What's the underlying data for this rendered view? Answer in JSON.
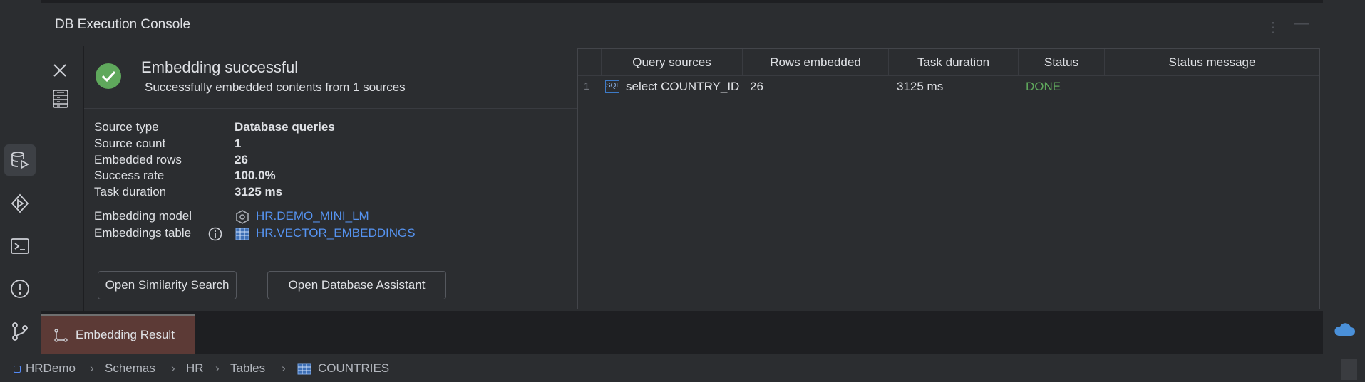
{
  "panel": {
    "title": "DB Execution Console"
  },
  "summary": {
    "title": "Embedding successful",
    "subtitle": "Successfully embedded contents from 1 sources",
    "fields": [
      {
        "label": "Source type",
        "value": "Database queries"
      },
      {
        "label": "Source count",
        "value": "1"
      },
      {
        "label": "Embedded rows",
        "value": "26"
      },
      {
        "label": "Success rate",
        "value": "100.0%"
      },
      {
        "label": "Task duration",
        "value": "3125 ms"
      }
    ],
    "embedding_model_label": "Embedding model",
    "embedding_model_value": "HR.DEMO_MINI_LM",
    "embeddings_table_label": "Embeddings table",
    "embeddings_table_value": "HR.VECTOR_EMBEDDINGS"
  },
  "buttons": {
    "similarity": "Open Similarity Search",
    "assistant": "Open Database Assistant"
  },
  "table": {
    "columns": [
      "Query sources",
      "Rows embedded",
      "Task duration",
      "Status",
      "Status message"
    ],
    "rows": [
      {
        "index": "1",
        "query": "select COUNTRY_ID",
        "rows": "26",
        "duration": "3125 ms",
        "status": "DONE",
        "message": ""
      }
    ],
    "sql_badge": "SQL",
    "status_color": "#5fa85c"
  },
  "bottom_tab": {
    "label": "Embedding Result"
  },
  "breadcrumb": [
    "HRDemo",
    "Schemas",
    "HR",
    "Tables",
    "COUNTRIES"
  ],
  "colors": {
    "accent_link": "#5694f2",
    "success": "#5fa85c",
    "active_tab": "#5c3a36"
  }
}
